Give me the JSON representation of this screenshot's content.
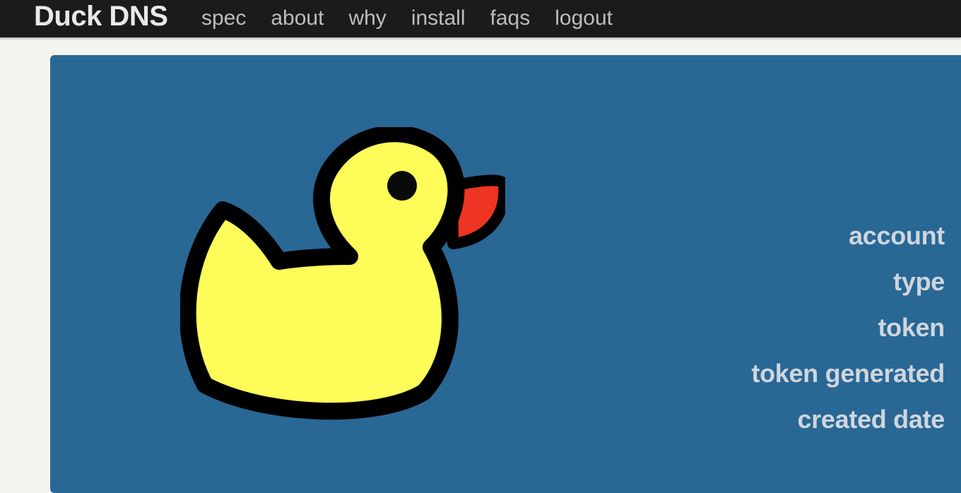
{
  "nav": {
    "brand": "Duck DNS",
    "links": [
      {
        "label": "spec"
      },
      {
        "label": "about"
      },
      {
        "label": "why"
      },
      {
        "label": "install"
      },
      {
        "label": "faqs"
      },
      {
        "label": "logout"
      }
    ]
  },
  "panel": {
    "logo_icon": "duck-icon",
    "info_labels": [
      "account",
      "type",
      "token",
      "token generated",
      "created date"
    ]
  },
  "colors": {
    "navbar_bg": "#1b1b1b",
    "page_bg": "#f4f3ef",
    "panel_bg": "#296795",
    "duck_body": "#fefc58",
    "duck_beak": "#ee3423",
    "label_text": "#cfd6dd"
  }
}
